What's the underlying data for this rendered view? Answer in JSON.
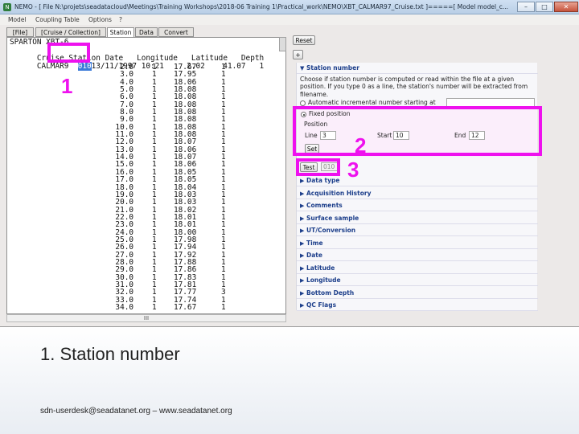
{
  "window": {
    "title": "NEMO - [ File N:\\projets\\seadatacloud\\Meetings\\Training Workshops\\2018-06 Training 1\\Practical_work\\NEMO\\XBT_CALMAR97_Cruise.txt ]=====[ Model model_c...",
    "minimize": "–",
    "maximize": "□",
    "close": "✕"
  },
  "menu": [
    "Model",
    "Coupling Table",
    "Options",
    "?"
  ],
  "tabs": [
    "[File]",
    "[Cruise / Collection]",
    "Station",
    "Data",
    "Convert"
  ],
  "file_view": {
    "line1": "SPARTON XBT-6",
    "line2_prefix": "Cruise",
    "line2_station": "Station",
    "line2_rest": "Date   Longitude   Latitude   Depth",
    "line3_prefix": "CALMAR9",
    "line3_selected": "010",
    "line3_rest": "13/11/1997 10:21     2.02    41.07   1",
    "rows": [
      [
        "2.0",
        "1",
        "17.67",
        "1"
      ],
      [
        "3.0",
        "1",
        "17.95",
        "1"
      ],
      [
        "4.0",
        "1",
        "18.06",
        "1"
      ],
      [
        "5.0",
        "1",
        "18.08",
        "1"
      ],
      [
        "6.0",
        "1",
        "18.08",
        "1"
      ],
      [
        "7.0",
        "1",
        "18.08",
        "1"
      ],
      [
        "8.0",
        "1",
        "18.08",
        "1"
      ],
      [
        "9.0",
        "1",
        "18.08",
        "1"
      ],
      [
        "10.0",
        "1",
        "18.08",
        "1"
      ],
      [
        "11.0",
        "1",
        "18.08",
        "1"
      ],
      [
        "12.0",
        "1",
        "18.07",
        "1"
      ],
      [
        "13.0",
        "1",
        "18.06",
        "1"
      ],
      [
        "14.0",
        "1",
        "18.07",
        "1"
      ],
      [
        "15.0",
        "1",
        "18.06",
        "1"
      ],
      [
        "16.0",
        "1",
        "18.05",
        "1"
      ],
      [
        "17.0",
        "1",
        "18.05",
        "1"
      ],
      [
        "18.0",
        "1",
        "18.04",
        "1"
      ],
      [
        "19.0",
        "1",
        "18.03",
        "1"
      ],
      [
        "20.0",
        "1",
        "18.03",
        "1"
      ],
      [
        "21.0",
        "1",
        "18.02",
        "1"
      ],
      [
        "22.0",
        "1",
        "18.01",
        "1"
      ],
      [
        "23.0",
        "1",
        "18.01",
        "1"
      ],
      [
        "24.0",
        "1",
        "18.00",
        "1"
      ],
      [
        "25.0",
        "1",
        "17.98",
        "1"
      ],
      [
        "26.0",
        "1",
        "17.94",
        "1"
      ],
      [
        "27.0",
        "1",
        "17.92",
        "1"
      ],
      [
        "28.0",
        "1",
        "17.88",
        "1"
      ],
      [
        "29.0",
        "1",
        "17.86",
        "1"
      ],
      [
        "30.0",
        "1",
        "17.83",
        "1"
      ],
      [
        "31.0",
        "1",
        "17.81",
        "1"
      ],
      [
        "32.0",
        "1",
        "17.77",
        "3"
      ],
      [
        "33.0",
        "1",
        "17.74",
        "1"
      ],
      [
        "34.0",
        "1",
        "17.67",
        "1"
      ]
    ],
    "scroll_grip": "III"
  },
  "right": {
    "reset_label": "Reset",
    "plus_label": "+",
    "station_section": "Station number",
    "station_desc": "Choose if station number is computed or read within the file at a given position. If you type 0 as a line, the station's number will be extracted from filename.",
    "auto_label": "Automatic incremental number starting at",
    "fixed_label": "Fixed position",
    "position_label": "Position",
    "line_label": "Line",
    "line_value": "3",
    "start_label": "Start",
    "start_value": "10",
    "end_label": "End",
    "end_value": "12",
    "set_label": "Set",
    "test_label": "Test",
    "test_result": "010",
    "sections": [
      "Data type",
      "Acquisition History",
      "Comments",
      "Surface sample",
      "UT/Conversion",
      "Time",
      "Date",
      "Latitude",
      "Longitude",
      "Bottom Depth",
      "QC Flags"
    ]
  },
  "annotations": {
    "callout_1": "1",
    "callout_2": "2",
    "callout_3": "3",
    "highlight_color": "#ee11ee"
  },
  "caption": "1. Station number",
  "footer": "sdn-userdesk@seadatanet.org – www.seadatanet.org"
}
